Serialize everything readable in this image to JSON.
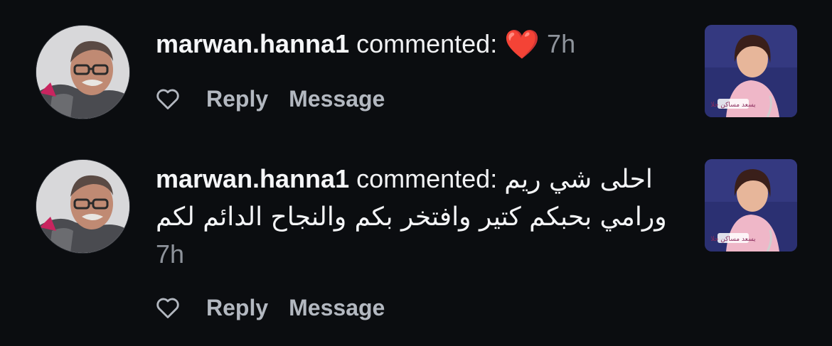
{
  "comments": [
    {
      "username": "marwan.hanna1",
      "verb": "commented:",
      "body": "❤️",
      "time": "7h",
      "actions": {
        "reply": "Reply",
        "message": "Message"
      },
      "avatar_icon": "person-photo",
      "thumb_icon": "post-thumbnail",
      "thumb_caption": "يسعد مساكن حلا"
    },
    {
      "username": "marwan.hanna1",
      "verb": "commented:",
      "body": "احلى شي ريم ورامي بحبكم كتير وافتخر بكم والنجاح الدائم لكم",
      "time": "7h",
      "actions": {
        "reply": "Reply",
        "message": "Message"
      },
      "avatar_icon": "person-photo",
      "thumb_icon": "post-thumbnail",
      "thumb_caption": "يسعد مساكن حلا"
    }
  ],
  "colors": {
    "background": "#0b0d10",
    "heart": "#ff2a3d",
    "muted": "#8e939b",
    "action": "#b3b8c0"
  }
}
